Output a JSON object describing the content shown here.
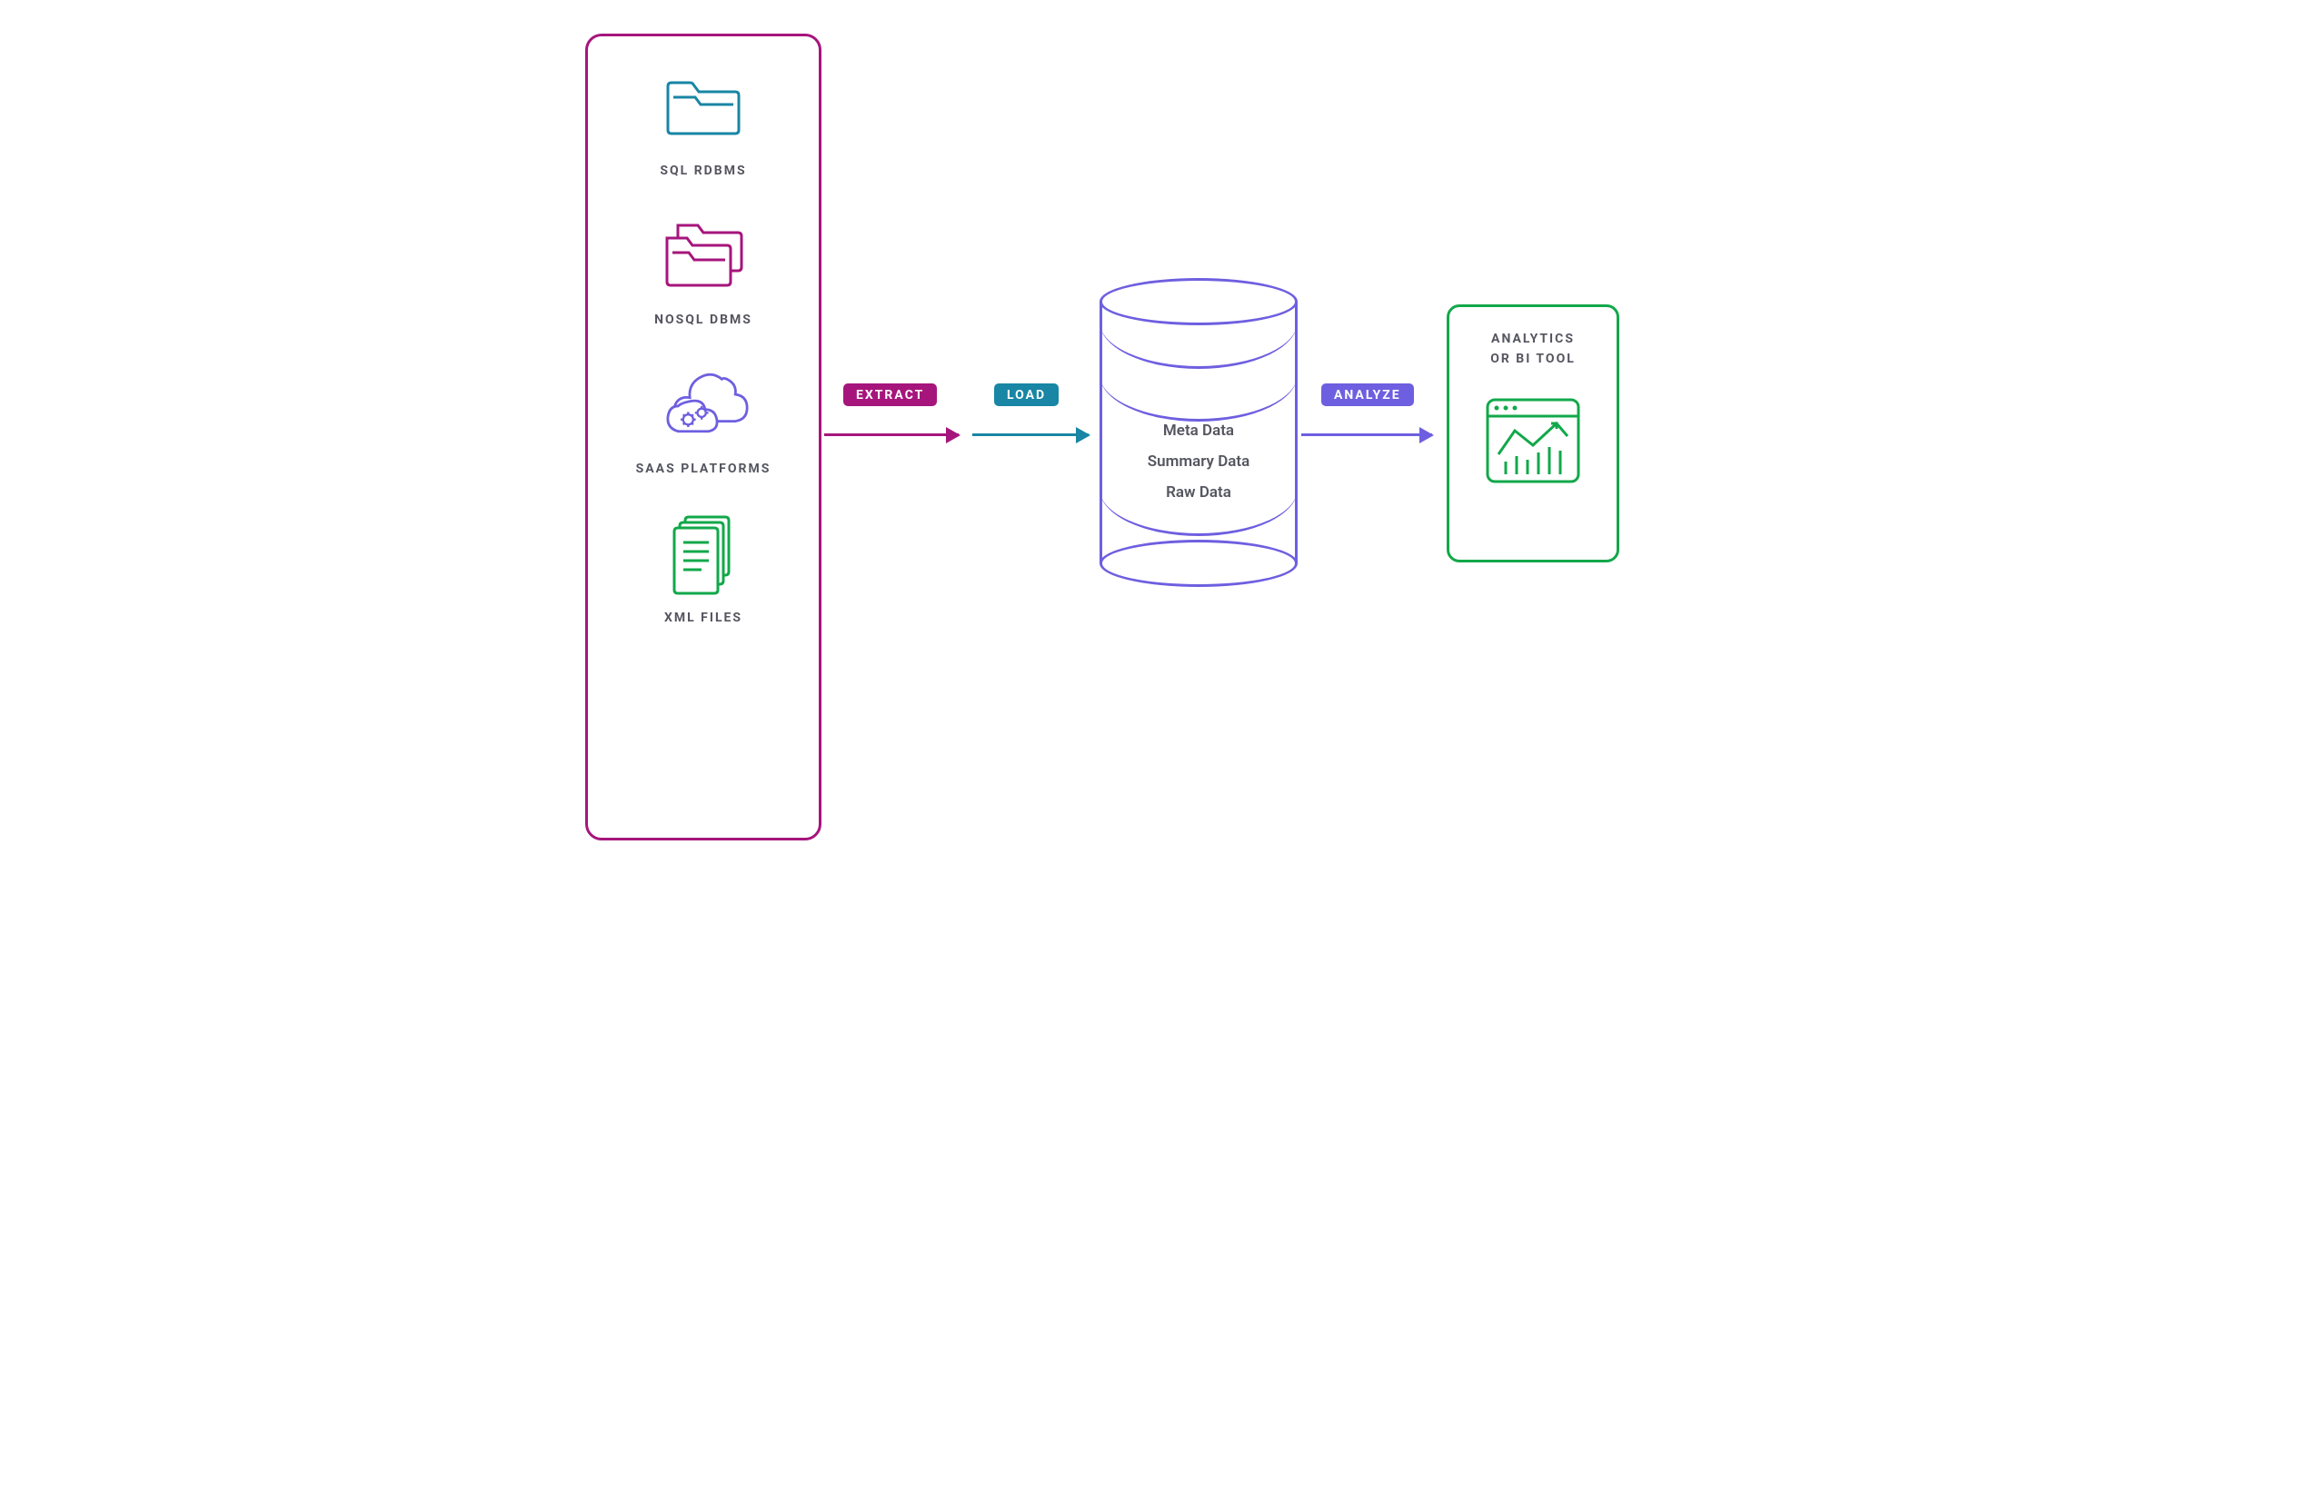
{
  "sources": {
    "items": [
      {
        "label": "SQL RDBMS"
      },
      {
        "label": "NOSQL DBMS"
      },
      {
        "label": "SAAS PLATFORMS"
      },
      {
        "label": "XML FILES"
      }
    ]
  },
  "steps": {
    "extract": "EXTRACT",
    "load": "LOAD",
    "analyze": "ANALYZE"
  },
  "database": {
    "rows": [
      "Meta Data",
      "Summary Data",
      "Raw Data"
    ]
  },
  "analytics": {
    "title_line1": "ANALYTICS",
    "title_line2": "OR BI TOOL"
  },
  "colors": {
    "magenta": "#A6157C",
    "teal": "#1886A4",
    "purple": "#6E5FE0",
    "green": "#12A84A",
    "text_gray": "#555560"
  }
}
